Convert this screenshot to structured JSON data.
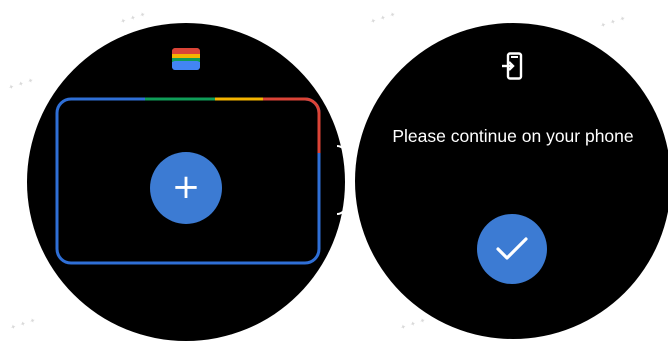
{
  "left_screen": {
    "wallet_icon": "wallet-icon",
    "add_button": {
      "icon": "plus-icon",
      "label": "+"
    },
    "card_frame_colors": {
      "red": "#db4437",
      "green": "#0f9d58",
      "yellow": "#f4b400",
      "blue": "#4285f4"
    }
  },
  "right_screen": {
    "phone_icon": "phone-transfer-icon",
    "message": "Please continue on your phone",
    "confirm_button": {
      "icon": "checkmark-icon"
    }
  },
  "colors": {
    "accent_button": "#3c7bd3",
    "screen_bg": "#000000"
  }
}
